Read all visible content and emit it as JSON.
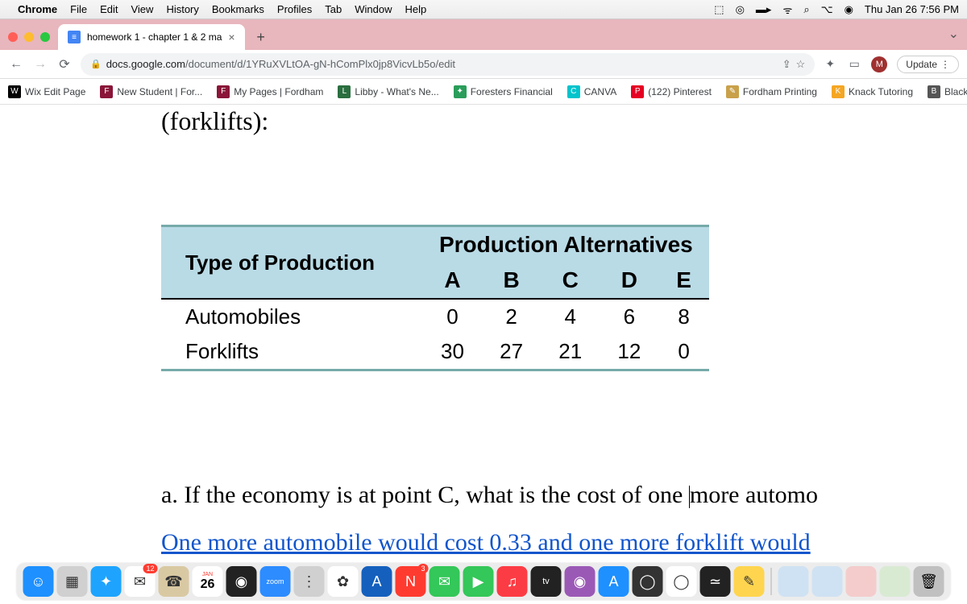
{
  "menubar": {
    "app": "Chrome",
    "items": [
      "File",
      "Edit",
      "View",
      "History",
      "Bookmarks",
      "Profiles",
      "Tab",
      "Window",
      "Help"
    ],
    "clock": "Thu Jan 26  7:56 PM"
  },
  "tab": {
    "title": "homework 1 - chapter 1 & 2 ma"
  },
  "omnibox": {
    "host": "docs.google.com",
    "path": "/document/d/1YRuXVLtOA-gN-hComPlx0jp8VicvLb5o/edit"
  },
  "toolbar": {
    "update": "Update",
    "avatar_letter": "M"
  },
  "bookmarks": [
    {
      "label": "Wix Edit Page",
      "color": "#000"
    },
    {
      "label": "New Student | For...",
      "color": "#8a1538"
    },
    {
      "label": "My Pages | Fordham",
      "color": "#8a1538"
    },
    {
      "label": "Libby - What's Ne...",
      "color": "#2a6e3f"
    },
    {
      "label": "Foresters Financial",
      "color": "#2a9d5a"
    },
    {
      "label": "CANVA",
      "color": "#00c4cc"
    },
    {
      "label": "(122) Pinterest",
      "color": "#e60023"
    },
    {
      "label": "Fordham Printing",
      "color": "#c9a14a"
    },
    {
      "label": "Knack Tutoring",
      "color": "#f5a623"
    },
    {
      "label": "Blackboard",
      "color": "#555"
    }
  ],
  "document": {
    "heading": "(forklifts):",
    "question": "a. If the economy is at point C, what is the cost of one more automo",
    "answer": "One more automobile would cost 0.33 and one more forklift would"
  },
  "chart_data": {
    "type": "table",
    "title": "Production Alternatives",
    "row_header_title": "Type of Production",
    "columns": [
      "A",
      "B",
      "C",
      "D",
      "E"
    ],
    "rows": [
      {
        "label": "Automobiles",
        "values": [
          0,
          2,
          4,
          6,
          8
        ]
      },
      {
        "label": "Forklifts",
        "values": [
          30,
          27,
          21,
          12,
          0
        ]
      }
    ]
  },
  "dock": {
    "calendar_month": "JAN",
    "calendar_day": "26",
    "mail_badge": "12",
    "news_badge": "3",
    "items": [
      {
        "name": "finder",
        "bg": "#1e90ff",
        "glyph": "☺"
      },
      {
        "name": "launchpad",
        "bg": "#d0d0d0",
        "glyph": "▦"
      },
      {
        "name": "safari",
        "bg": "#1ea4ff",
        "glyph": "✦"
      },
      {
        "name": "mail",
        "bg": "#ffffff",
        "glyph": "✉",
        "badge": "12"
      },
      {
        "name": "contacts",
        "bg": "#d9c9a3",
        "glyph": "☎"
      },
      {
        "name": "calendar",
        "bg": "#ffffff",
        "glyph": ""
      },
      {
        "name": "siri",
        "bg": "#222",
        "glyph": "◉"
      },
      {
        "name": "zoom",
        "bg": "#2d8cff",
        "glyph": "zoom"
      },
      {
        "name": "menu",
        "bg": "#d0d0d0",
        "glyph": "⋮"
      },
      {
        "name": "photos",
        "bg": "#fff",
        "glyph": "✿"
      },
      {
        "name": "autodesk",
        "bg": "#1560bd",
        "glyph": "A"
      },
      {
        "name": "news",
        "bg": "#ff3b30",
        "glyph": "N",
        "badge": "3"
      },
      {
        "name": "messages",
        "bg": "#34c759",
        "glyph": "✉"
      },
      {
        "name": "facetime",
        "bg": "#34c759",
        "glyph": "▶"
      },
      {
        "name": "music",
        "bg": "#fc3c44",
        "glyph": "♫"
      },
      {
        "name": "tv",
        "bg": "#222",
        "glyph": "tv"
      },
      {
        "name": "podcasts",
        "bg": "#9b59b6",
        "glyph": "◉"
      },
      {
        "name": "appstore",
        "bg": "#1e90ff",
        "glyph": "A"
      },
      {
        "name": "creative",
        "bg": "#333",
        "glyph": "◯"
      },
      {
        "name": "chrome",
        "bg": "#fff",
        "glyph": "◯"
      },
      {
        "name": "stocks",
        "bg": "#222",
        "glyph": "≃"
      },
      {
        "name": "notes",
        "bg": "#ffd54f",
        "glyph": "✎"
      }
    ],
    "right_items": [
      {
        "name": "docx",
        "bg": "#cfe2f3",
        "glyph": ""
      },
      {
        "name": "file1",
        "bg": "#cfe2f3",
        "glyph": ""
      },
      {
        "name": "file2",
        "bg": "#f4cccc",
        "glyph": ""
      },
      {
        "name": "file3",
        "bg": "#d9ead3",
        "glyph": ""
      },
      {
        "name": "trash",
        "bg": "#c0c0c0",
        "glyph": "🗑"
      }
    ]
  }
}
